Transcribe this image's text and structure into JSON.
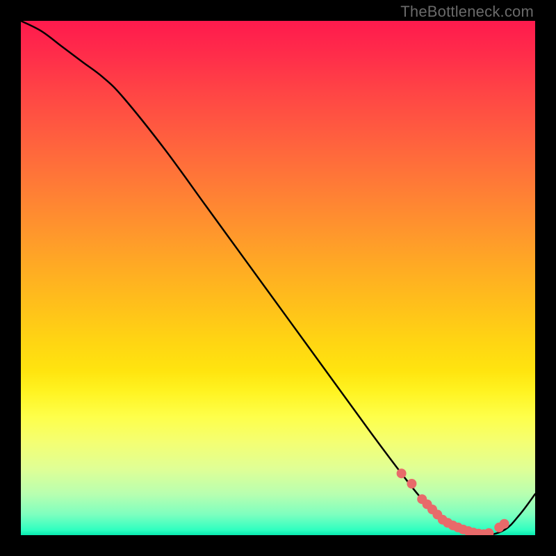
{
  "watermark": {
    "text": "TheBottleneck.com"
  },
  "chart_data": {
    "type": "line",
    "title": "",
    "xlabel": "",
    "ylabel": "",
    "ylim": [
      0,
      100
    ],
    "xlim": [
      0,
      100
    ],
    "series": [
      {
        "name": "curve",
        "x": [
          0,
          4,
          8,
          12,
          16,
          20,
          28,
          36,
          44,
          52,
          60,
          68,
          74,
          78,
          82,
          86,
          90,
          94,
          97,
          100
        ],
        "y": [
          100,
          98,
          95,
          92,
          89,
          85,
          75,
          64,
          53,
          42,
          31,
          20,
          12,
          7,
          3,
          1,
          0,
          1,
          4,
          8
        ]
      }
    ],
    "markers": {
      "name": "highlight-dots",
      "x": [
        74,
        76,
        78,
        79,
        80,
        81,
        82,
        83,
        84,
        85,
        86,
        87,
        88,
        89,
        90,
        91,
        93,
        94
      ],
      "y": [
        12,
        10,
        7,
        6,
        5,
        4,
        3,
        2.4,
        1.9,
        1.5,
        1.1,
        0.8,
        0.5,
        0.3,
        0.2,
        0.4,
        1.5,
        2.2
      ],
      "color": "#e86a6a",
      "radius_px": 7
    },
    "background": {
      "type": "vertical-gradient",
      "stops": [
        {
          "pos": 0.0,
          "color": "#ff1a4d"
        },
        {
          "pos": 0.5,
          "color": "#ffae22"
        },
        {
          "pos": 0.78,
          "color": "#feff4a"
        },
        {
          "pos": 0.95,
          "color": "#7dffbf"
        },
        {
          "pos": 1.0,
          "color": "#08eab0"
        }
      ]
    }
  }
}
